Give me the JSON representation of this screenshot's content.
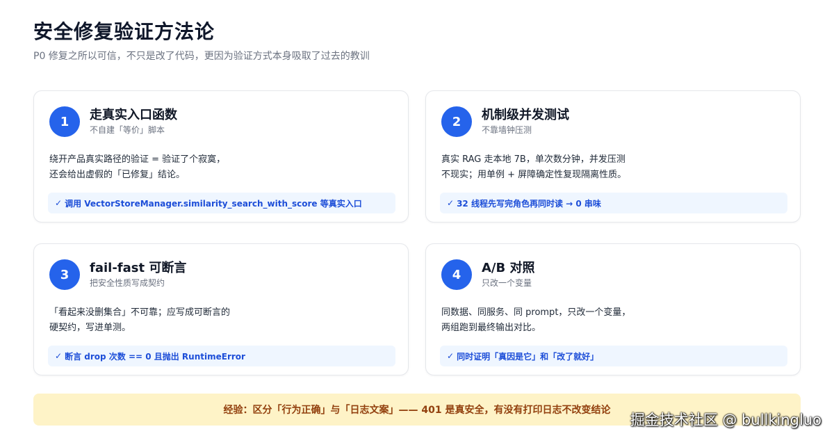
{
  "header": {
    "title": "安全修复验证方法论",
    "subtitle": "P0 修复之所以可信，不只是改了代码，更因为验证方式本身吸取了过去的教训"
  },
  "cards": [
    {
      "number": "1",
      "title": "走真实入口函数",
      "subtitle": "不自建「等价」脚本",
      "desc": [
        "绕开产品真实路径的验证 = 验证了个寂寞，",
        "还会给出虚假的「已修复」结论。"
      ],
      "check": "调用 VectorStoreManager.similarity_search_with_score 等真实入口"
    },
    {
      "number": "2",
      "title": "机制级并发测试",
      "subtitle": "不靠墙钟压测",
      "desc": [
        "真实 RAG 走本地 7B，单次数分钟，并发压测",
        "不现实；用单例 + 屏障确定性复现隔离性质。"
      ],
      "check": "32 线程先写完角色再同时读 → 0 串味"
    },
    {
      "number": "3",
      "title": "fail-fast 可断言",
      "subtitle": "把安全性质写成契约",
      "desc": [
        "「看起来没删集合」不可靠；应写成可断言的",
        "硬契约，写进单测。"
      ],
      "check": "断言 drop 次数 == 0 且抛出 RuntimeError"
    },
    {
      "number": "4",
      "title": "A/B 对照",
      "subtitle": "只改一个变量",
      "desc": [
        "同数据、同服务、同 prompt，只改一个变量，",
        "两组跑到最终输出对比。"
      ],
      "check": "同时证明「真因是它」和「改了就好」"
    }
  ],
  "check_mark": "✓",
  "lesson": "经验：区分「行为正确」与「日志文案」—— 401 是真安全，有没有打印日志不改变结论",
  "watermark": "掘金技术社区 @ bullkingluo",
  "colors": {
    "accent": "#2563eb",
    "pill_bg": "#eff6ff",
    "pill_text": "#1d4ed8",
    "lesson_bg": "#fef3c7",
    "lesson_text": "#92400e"
  }
}
